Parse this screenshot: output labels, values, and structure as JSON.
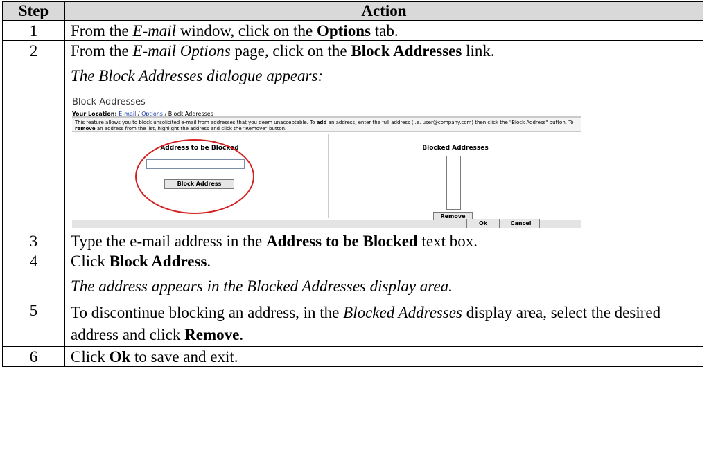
{
  "table": {
    "headers": {
      "step": "Step",
      "action": "Action"
    },
    "rows": [
      {
        "step": "1",
        "parts": [
          {
            "t": "From the "
          },
          {
            "t": "E-mail",
            "i": true
          },
          {
            "t": " window, click on the "
          },
          {
            "t": "Options",
            "b": true
          },
          {
            "t": " tab."
          }
        ]
      },
      {
        "step": "2",
        "parts": [
          {
            "t": "From the "
          },
          {
            "t": "E-mail Options",
            "i": true
          },
          {
            "t": " page, click on the "
          },
          {
            "t": "Block Addresses",
            "b": true
          },
          {
            "t": " link."
          }
        ],
        "note": "The Block Addresses dialogue appears:"
      },
      {
        "step": "3",
        "parts": [
          {
            "t": "Type the e-mail address in the "
          },
          {
            "t": "Address to be Blocked",
            "b": true
          },
          {
            "t": " text box."
          }
        ]
      },
      {
        "step": "4",
        "parts": [
          {
            "t": "Click "
          },
          {
            "t": "Block Address",
            "b": true
          },
          {
            "t": "."
          }
        ],
        "note": "The address appears in the Blocked Addresses display area."
      },
      {
        "step": "5",
        "parts": [
          {
            "t": "To discontinue blocking an address, in the "
          },
          {
            "t": "Blocked Addresses",
            "i": true
          },
          {
            "t": " display area, select the desired address and click "
          },
          {
            "t": "Remove",
            "b": true
          },
          {
            "t": "."
          }
        ]
      },
      {
        "step": "6",
        "parts": [
          {
            "t": "Click "
          },
          {
            "t": "Ok",
            "b": true
          },
          {
            "t": " to save and exit."
          }
        ]
      }
    ]
  },
  "dialog": {
    "title": "Block Addresses",
    "location_label": "Your Location:",
    "crumb_email": "E-mail",
    "crumb_sep1": " / ",
    "crumb_options": "Options",
    "crumb_sep2": " / ",
    "crumb_current": "Block Addresses",
    "info_parts": [
      {
        "t": "This feature allows you to block unsolicited e-mail from addresses that you deem unacceptable. To "
      },
      {
        "t": "add",
        "b": true
      },
      {
        "t": " an address, enter the full address (i.e. user@company.com) then click the \"Block Address\" button. To "
      },
      {
        "t": "remove",
        "b": true
      },
      {
        "t": " an address from the list, highlight the address and click the \"Remove\" button."
      }
    ],
    "left_title": "Address to be Blocked",
    "input_value": "",
    "block_button": "Block Address",
    "right_title": "Blocked Addresses",
    "remove_button": "Remove",
    "ok_button": "Ok",
    "cancel_button": "Cancel",
    "highlight_color": "#d42020"
  }
}
